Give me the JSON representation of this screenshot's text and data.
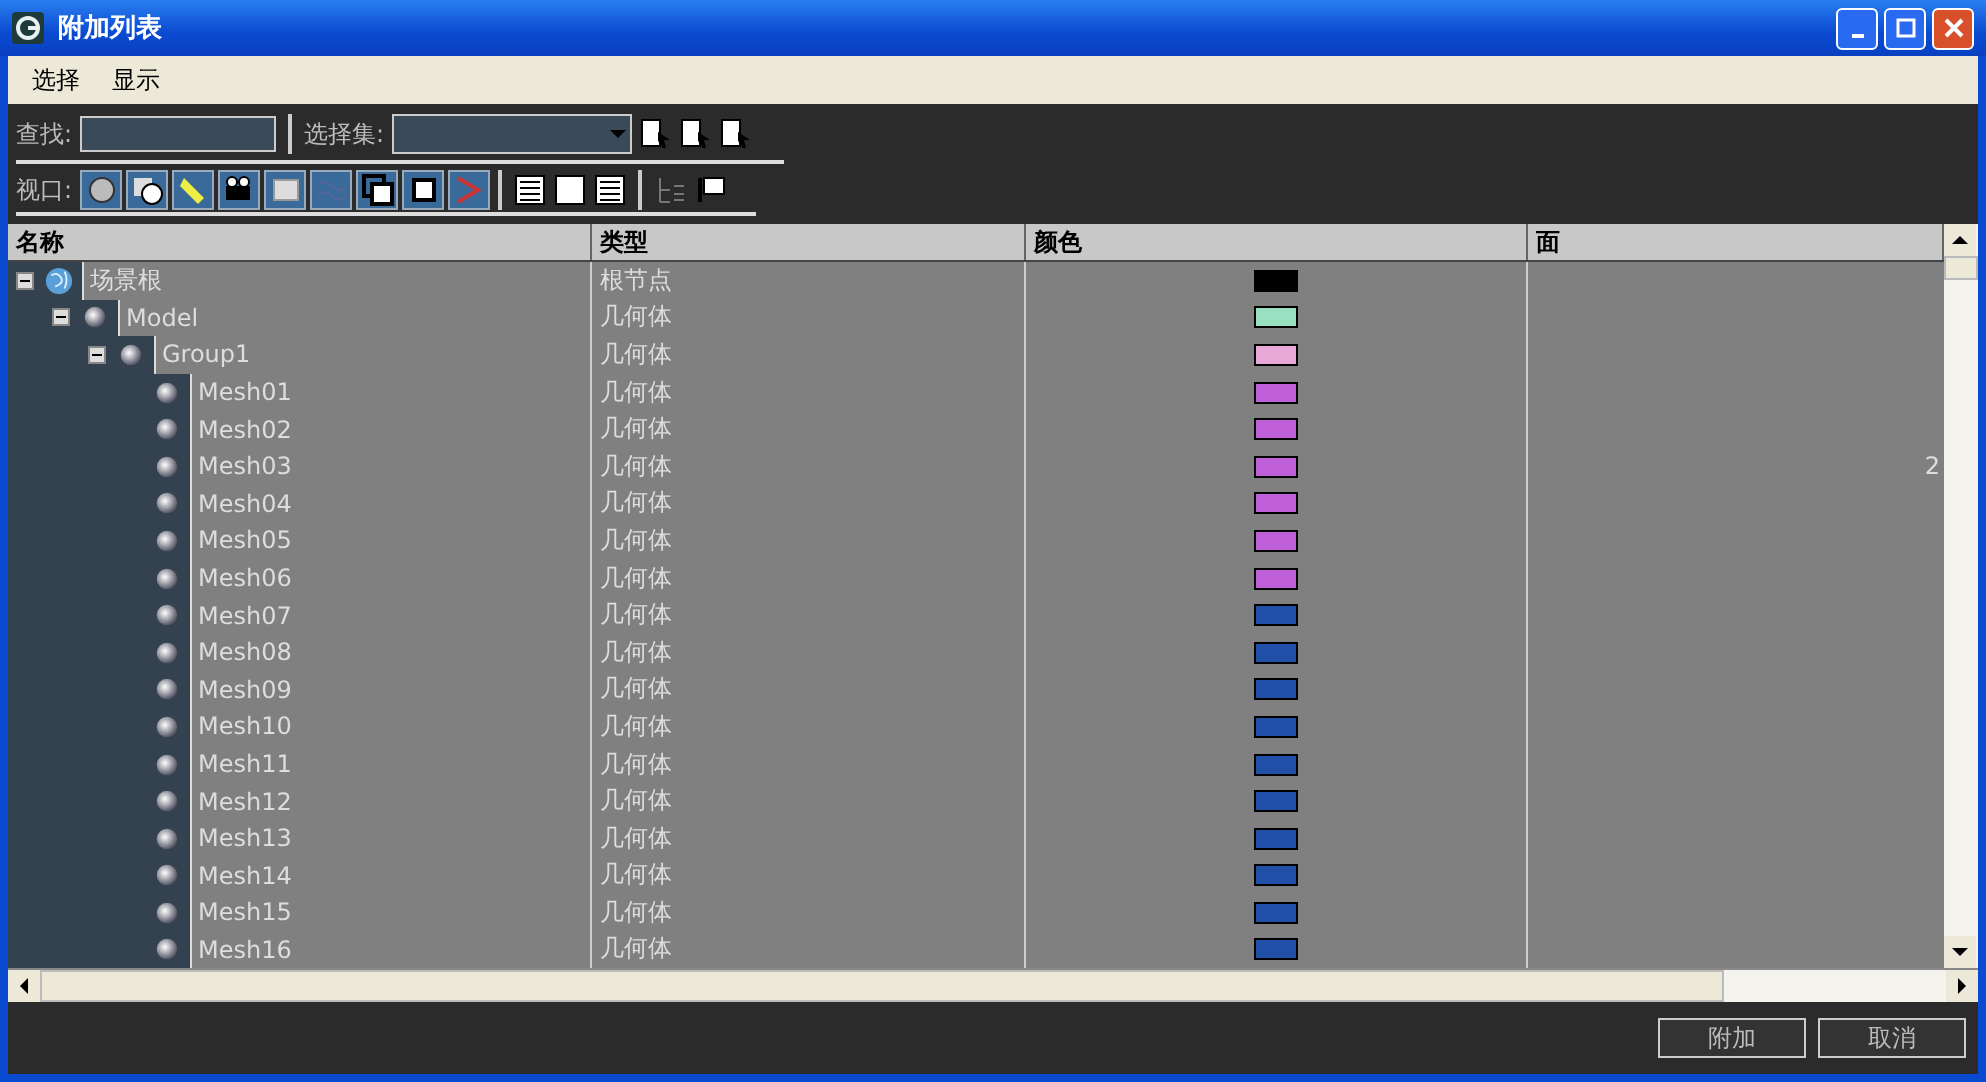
{
  "window": {
    "title": "附加列表"
  },
  "menu": [
    "选择",
    "显示"
  ],
  "find": {
    "label": "查找:"
  },
  "selection_set": {
    "label": "选择集:"
  },
  "viewport": {
    "label": "视口:"
  },
  "table": {
    "columns": [
      "名称",
      "类型",
      "颜色",
      "面"
    ],
    "rows": [
      {
        "name": "场景根",
        "kind": "root",
        "type": "根节点",
        "color": "#000000",
        "expanded": true,
        "children": [
          {
            "name": "Model",
            "kind": "object",
            "type": "几何体",
            "color": "#99e0c0",
            "expanded": true,
            "children": [
              {
                "name": "Group1",
                "kind": "object",
                "type": "几何体",
                "color": "#e8a8d8",
                "expanded": true,
                "children": [
                  {
                    "name": "Mesh01",
                    "kind": "object",
                    "type": "几何体",
                    "color": "#c060d8"
                  },
                  {
                    "name": "Mesh02",
                    "kind": "object",
                    "type": "几何体",
                    "color": "#c060d8"
                  },
                  {
                    "name": "Mesh03",
                    "kind": "object",
                    "type": "几何体",
                    "color": "#c060d8",
                    "faces": "2"
                  },
                  {
                    "name": "Mesh04",
                    "kind": "object",
                    "type": "几何体",
                    "color": "#c060d8"
                  },
                  {
                    "name": "Mesh05",
                    "kind": "object",
                    "type": "几何体",
                    "color": "#c060d8"
                  },
                  {
                    "name": "Mesh06",
                    "kind": "object",
                    "type": "几何体",
                    "color": "#c060d8"
                  },
                  {
                    "name": "Mesh07",
                    "kind": "object",
                    "type": "几何体",
                    "color": "#2050a8"
                  },
                  {
                    "name": "Mesh08",
                    "kind": "object",
                    "type": "几何体",
                    "color": "#2050a8"
                  },
                  {
                    "name": "Mesh09",
                    "kind": "object",
                    "type": "几何体",
                    "color": "#2050a8"
                  },
                  {
                    "name": "Mesh10",
                    "kind": "object",
                    "type": "几何体",
                    "color": "#2050a8"
                  },
                  {
                    "name": "Mesh11",
                    "kind": "object",
                    "type": "几何体",
                    "color": "#2050a8"
                  },
                  {
                    "name": "Mesh12",
                    "kind": "object",
                    "type": "几何体",
                    "color": "#2050a8"
                  },
                  {
                    "name": "Mesh13",
                    "kind": "object",
                    "type": "几何体",
                    "color": "#2050a8"
                  },
                  {
                    "name": "Mesh14",
                    "kind": "object",
                    "type": "几何体",
                    "color": "#2050a8"
                  },
                  {
                    "name": "Mesh15",
                    "kind": "object",
                    "type": "几何体",
                    "color": "#2050a8"
                  },
                  {
                    "name": "Mesh16",
                    "kind": "object",
                    "type": "几何体",
                    "color": "#2050a8"
                  }
                ]
              }
            ]
          }
        ]
      }
    ]
  },
  "buttons": [
    "附加",
    "取消"
  ]
}
